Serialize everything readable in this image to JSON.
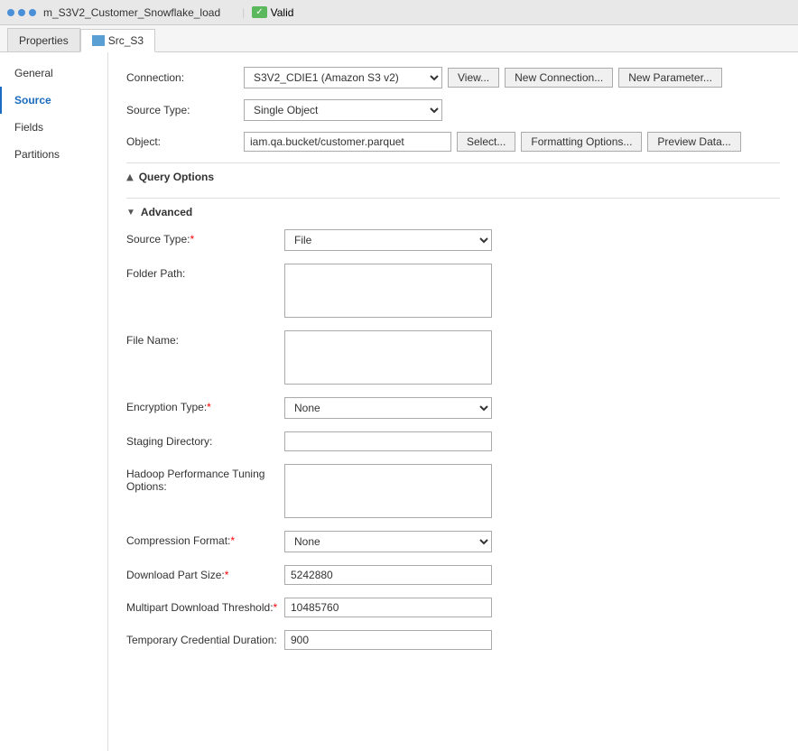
{
  "titleBar": {
    "appTitle": "m_S3V2_Customer_Snowflake_load",
    "validLabel": "Valid"
  },
  "tabs": [
    {
      "id": "properties",
      "label": "Properties",
      "icon": false,
      "active": false
    },
    {
      "id": "src_s3",
      "label": "Src_S3",
      "icon": true,
      "active": true
    }
  ],
  "sidebar": {
    "items": [
      {
        "id": "general",
        "label": "General",
        "active": false
      },
      {
        "id": "source",
        "label": "Source",
        "active": true
      },
      {
        "id": "fields",
        "label": "Fields",
        "active": false
      },
      {
        "id": "partitions",
        "label": "Partitions",
        "active": false
      }
    ]
  },
  "form": {
    "connection": {
      "label": "Connection:",
      "value": "S3V2_CDIE1 (Amazon S3 v2)",
      "viewBtn": "View...",
      "newConnectionBtn": "New Connection...",
      "newParameterBtn": "New Parameter..."
    },
    "sourceType": {
      "label": "Source Type:",
      "value": "Single Object"
    },
    "object": {
      "label": "Object:",
      "value": "iam.qa.bucket/customer.parquet",
      "selectBtn": "Select...",
      "formattingBtn": "Formatting Options...",
      "previewBtn": "Preview Data..."
    },
    "queryOptions": {
      "label": "Query Options",
      "collapsed": true
    },
    "advanced": {
      "label": "Advanced",
      "collapsed": false,
      "fields": {
        "sourceType": {
          "label": "Source Type:",
          "required": true,
          "value": "File"
        },
        "folderPath": {
          "label": "Folder Path:",
          "required": false,
          "value": ""
        },
        "fileName": {
          "label": "File Name:",
          "required": false,
          "value": ""
        },
        "encryptionType": {
          "label": "Encryption Type:",
          "required": true,
          "value": "None"
        },
        "stagingDirectory": {
          "label": "Staging Directory:",
          "required": false,
          "value": ""
        },
        "hadoopPerformance": {
          "label": "Hadoop Performance Tuning Options:",
          "required": false,
          "value": ""
        },
        "compressionFormat": {
          "label": "Compression Format:",
          "required": true,
          "value": "None"
        },
        "downloadPartSize": {
          "label": "Download Part Size:",
          "required": true,
          "value": "5242880"
        },
        "multipartDownloadThreshold": {
          "label": "Multipart Download Threshold:",
          "required": true,
          "value": "10485760"
        },
        "temporalCredentialDuration": {
          "label": "Temporary Credential Duration:",
          "required": false,
          "value": "900"
        }
      }
    }
  }
}
